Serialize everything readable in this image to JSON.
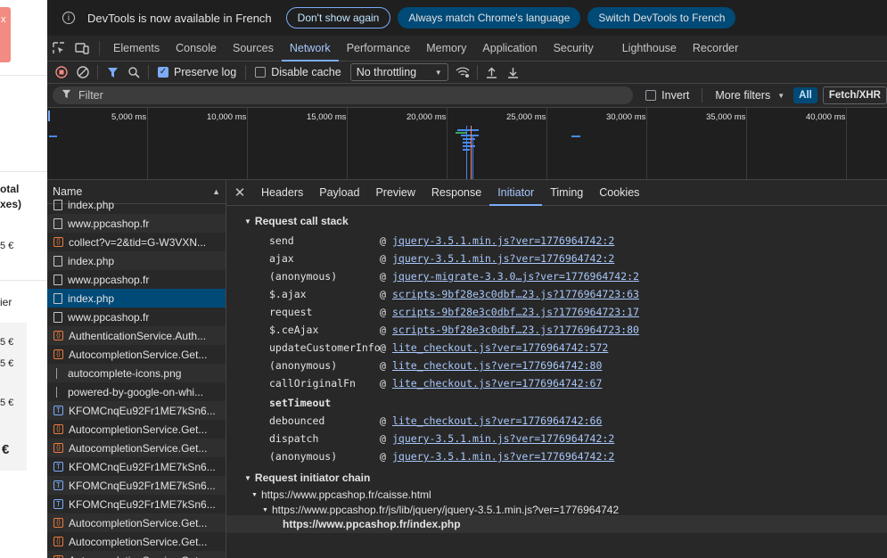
{
  "page": {
    "err_close": "x",
    "partial_texts": [
      "otal",
      "xes)",
      "5 €",
      "ier",
      "5 €",
      "5 €",
      "5 €",
      "€"
    ]
  },
  "infobar": {
    "message": "DevTools is now available in French",
    "dont_show": "Don't show again",
    "match_language": "Always match Chrome's language",
    "switch_language": "Switch DevTools to French"
  },
  "tabs": [
    "Elements",
    "Console",
    "Sources",
    "Network",
    "Performance",
    "Memory",
    "Application",
    "Security",
    "Lighthouse",
    "Recorder"
  ],
  "active_tab": "Network",
  "toolbar": {
    "preserve_log": "Preserve log",
    "disable_cache": "Disable cache",
    "throttling": "No throttling"
  },
  "filterbar": {
    "placeholder": "Filter",
    "invert": "Invert",
    "more_filters": "More filters",
    "all": "All",
    "fetch_xhr": "Fetch/XHR"
  },
  "overview": {
    "ticks": [
      "5,000 ms",
      "10,000 ms",
      "15,000 ms",
      "20,000 ms",
      "25,000 ms",
      "30,000 ms",
      "35,000 ms",
      "40,000 ms"
    ]
  },
  "requests": {
    "header": "Name",
    "rows": [
      {
        "name": "index.php",
        "type": "doc"
      },
      {
        "name": "www.ppcashop.fr",
        "type": "doc"
      },
      {
        "name": "collect?v=2&tid=G-W3VXN...",
        "type": "xhr"
      },
      {
        "name": "index.php",
        "type": "doc"
      },
      {
        "name": "www.ppcashop.fr",
        "type": "doc"
      },
      {
        "name": "index.php",
        "type": "doc",
        "selected": true
      },
      {
        "name": "www.ppcashop.fr",
        "type": "doc"
      },
      {
        "name": "AuthenticationService.Auth...",
        "type": "xhr"
      },
      {
        "name": "AutocompletionService.Get...",
        "type": "xhr"
      },
      {
        "name": "autocomplete-icons.png",
        "type": "img"
      },
      {
        "name": "powered-by-google-on-whi...",
        "type": "img"
      },
      {
        "name": "KFOMCnqEu92Fr1ME7kSn6...",
        "type": "font"
      },
      {
        "name": "AutocompletionService.Get...",
        "type": "xhr"
      },
      {
        "name": "AutocompletionService.Get...",
        "type": "xhr"
      },
      {
        "name": "KFOMCnqEu92Fr1ME7kSn6...",
        "type": "font"
      },
      {
        "name": "KFOMCnqEu92Fr1ME7kSn6...",
        "type": "font"
      },
      {
        "name": "KFOMCnqEu92Fr1ME7kSn6...",
        "type": "font"
      },
      {
        "name": "AutocompletionService.Get...",
        "type": "xhr"
      },
      {
        "name": "AutocompletionService.Get...",
        "type": "xhr"
      },
      {
        "name": "AutocompletionService.Get...",
        "type": "xhr"
      }
    ]
  },
  "detail_tabs": [
    "Headers",
    "Payload",
    "Preview",
    "Response",
    "Initiator",
    "Timing",
    "Cookies"
  ],
  "active_detail_tab": "Initiator",
  "call_stack": {
    "title": "Request call stack",
    "at": "@",
    "frames": [
      {
        "fn": "send",
        "link": "jquery-3.5.1.min.js?ver=1776964742:2"
      },
      {
        "fn": "ajax",
        "link": "jquery-3.5.1.min.js?ver=1776964742:2"
      },
      {
        "fn": "(anonymous)",
        "link": "jquery-migrate-3.3.0…js?ver=1776964742:2"
      },
      {
        "fn": "$.ajax",
        "link": "scripts-9bf28e3c0dbf…23.js?1776964723:63"
      },
      {
        "fn": "request",
        "link": "scripts-9bf28e3c0dbf…23.js?1776964723:17"
      },
      {
        "fn": "$.ceAjax",
        "link": "scripts-9bf28e3c0dbf…23.js?1776964723:80"
      },
      {
        "fn": "updateCustomerInfo",
        "link": "lite_checkout.js?ver=1776964742:572"
      },
      {
        "fn": "(anonymous)",
        "link": "lite_checkout.js?ver=1776964742:80"
      },
      {
        "fn": "callOriginalFn",
        "link": "lite_checkout.js?ver=1776964742:67"
      },
      {
        "fn": "setTimeout",
        "link": ""
      },
      {
        "fn": "debounced",
        "link": "lite_checkout.js?ver=1776964742:66"
      },
      {
        "fn": "dispatch",
        "link": "jquery-3.5.1.min.js?ver=1776964742:2"
      },
      {
        "fn": "(anonymous)",
        "link": "jquery-3.5.1.min.js?ver=1776964742:2"
      }
    ]
  },
  "initiator_chain": {
    "title": "Request initiator chain",
    "level1": "https://www.ppcashop.fr/caisse.html",
    "level2": "https://www.ppcashop.fr/js/lib/jquery/jquery-3.5.1.min.js?ver=1776964742",
    "level3": "https://www.ppcashop.fr/index.php"
  },
  "colors": {
    "accent": "#7cacf8",
    "selected_row": "#004a77"
  }
}
